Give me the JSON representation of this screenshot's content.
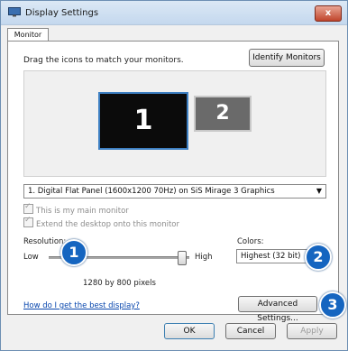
{
  "window": {
    "title": "Display Settings",
    "close_label": "x"
  },
  "tabs": [
    {
      "label": "Monitor"
    }
  ],
  "monitor": {
    "instructions": "Drag the icons to match your monitors.",
    "identify_label": "Identify Monitors",
    "monitors": [
      {
        "number": "1"
      },
      {
        "number": "2"
      }
    ],
    "selected_display": "1. Digital Flat Panel (1600x1200 70Hz) on SiS Mirage 3 Graphics",
    "main_monitor_label": "This is my main monitor",
    "extend_label": "Extend the desktop onto this monitor"
  },
  "resolution": {
    "label": "Resolution:",
    "low": "Low",
    "high": "High",
    "value_text": "1280 by 800 pixels",
    "slider_level": 0.94
  },
  "colors": {
    "label": "Colors:",
    "value": "Highest (32 bit)"
  },
  "help_link": "How do I get the best display?",
  "advanced_label": "Advanced Settings...",
  "buttons": {
    "ok": "OK",
    "cancel": "Cancel",
    "apply": "Apply"
  },
  "badges": {
    "b1": "1",
    "b2": "2",
    "b3": "3"
  },
  "colors_theme": {
    "badge": "#1565c0",
    "link": "#0645ad",
    "monitor_border": "#3d7fc2"
  }
}
